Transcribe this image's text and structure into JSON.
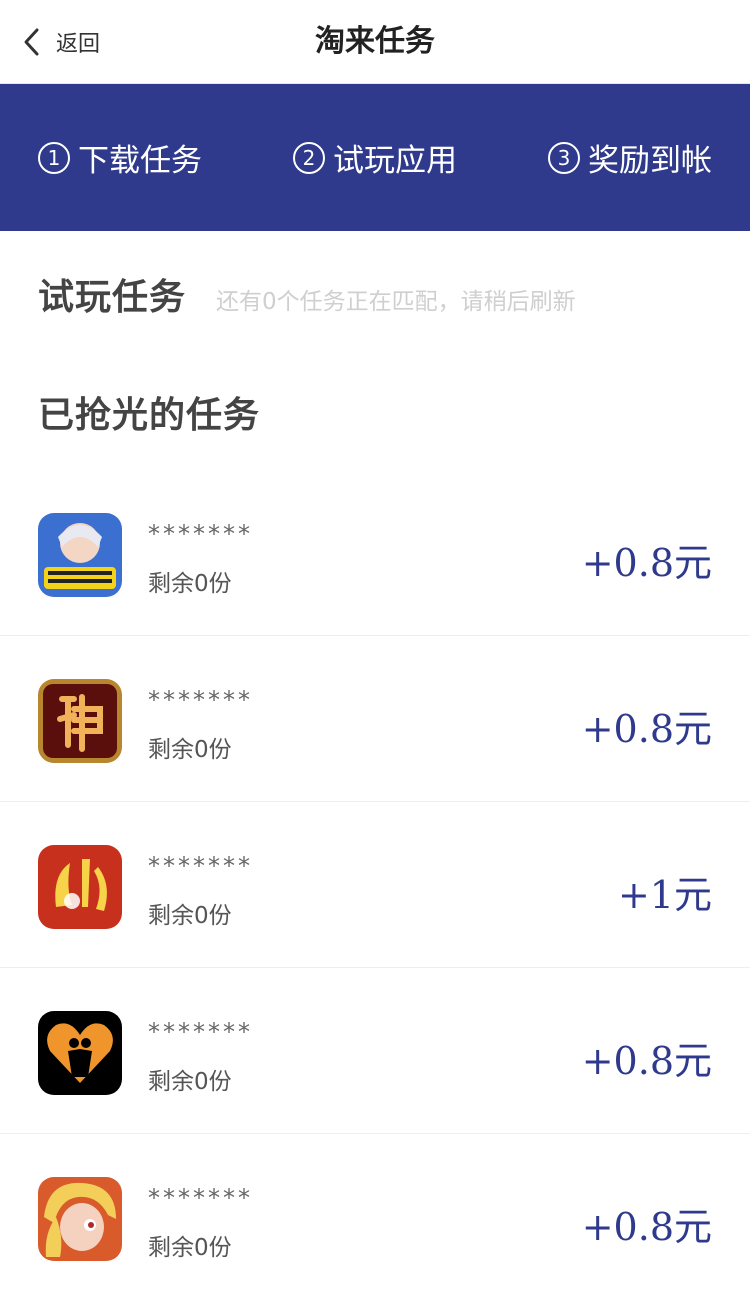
{
  "nav": {
    "back_label": "返回",
    "title": "淘来任务"
  },
  "steps": [
    {
      "num": "1",
      "label": "下载任务"
    },
    {
      "num": "2",
      "label": "试玩应用"
    },
    {
      "num": "3",
      "label": "奖励到帐"
    }
  ],
  "trial": {
    "title": "试玩任务",
    "hint": "还有0个任务正在匹配，请稍后刷新"
  },
  "sold_out": {
    "title": "已抢光的任务"
  },
  "tasks": [
    {
      "name": "*******",
      "remain": "剩余0份",
      "reward": "+0.8元",
      "icon": "game-icon-anime-hero"
    },
    {
      "name": "*******",
      "remain": "剩余0份",
      "reward": "+0.8元",
      "icon": "game-icon-shen"
    },
    {
      "name": "*******",
      "remain": "剩余0份",
      "reward": "+1元",
      "icon": "game-icon-xian"
    },
    {
      "name": "*******",
      "remain": "剩余0份",
      "reward": "+0.8元",
      "icon": "app-icon-heart-couple"
    },
    {
      "name": "*******",
      "remain": "剩余0份",
      "reward": "+0.8元",
      "icon": "game-icon-blonde-hero"
    }
  ],
  "colors": {
    "accent": "#2f3a8c",
    "hint": "#cfcfcf"
  }
}
